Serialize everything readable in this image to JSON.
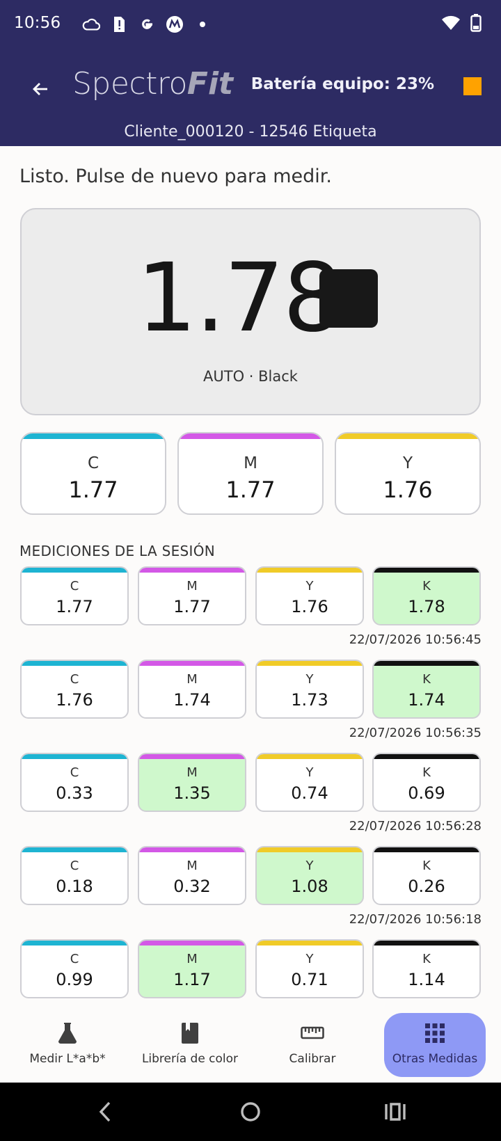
{
  "status_bar": {
    "time": "10:56",
    "left_icons": [
      "cloud-icon",
      "sim-alert-icon",
      "google-icon",
      "motorola-icon",
      "dot-icon"
    ],
    "right_icons": [
      "wifi-icon",
      "battery-icon"
    ]
  },
  "header": {
    "logo_part1": "Spectro",
    "logo_part2": "Fit",
    "battery_label": "Batería equipo: 23%",
    "battery_color": "#ffa200",
    "client_line": "Cliente_000120 - 12546 Etiqueta"
  },
  "message": "Listo. Pulse de nuevo para medir.",
  "reading": {
    "value": "1.78",
    "mode": "AUTO · Black",
    "swatch_color": "#181818"
  },
  "cmy": [
    {
      "label": "C",
      "value": "1.77",
      "color": "#1eb4d2"
    },
    {
      "label": "M",
      "value": "1.77",
      "color": "#d358e6"
    },
    {
      "label": "Y",
      "value": "1.76",
      "color": "#f0cb28"
    }
  ],
  "session_title": "MEDICIONES DE LA SESIÓN",
  "channel_colors": {
    "C": "#1eb4d2",
    "M": "#d358e6",
    "Y": "#f0cb28",
    "K": "#111111"
  },
  "session": [
    {
      "timestamp": "22/07/2026 10:56:45",
      "cells": [
        {
          "label": "C",
          "value": "1.77",
          "highlight": false
        },
        {
          "label": "M",
          "value": "1.77",
          "highlight": false
        },
        {
          "label": "Y",
          "value": "1.76",
          "highlight": false
        },
        {
          "label": "K",
          "value": "1.78",
          "highlight": true
        }
      ]
    },
    {
      "timestamp": "22/07/2026 10:56:35",
      "cells": [
        {
          "label": "C",
          "value": "1.76",
          "highlight": false
        },
        {
          "label": "M",
          "value": "1.74",
          "highlight": false
        },
        {
          "label": "Y",
          "value": "1.73",
          "highlight": false
        },
        {
          "label": "K",
          "value": "1.74",
          "highlight": true
        }
      ]
    },
    {
      "timestamp": "22/07/2026 10:56:28",
      "cells": [
        {
          "label": "C",
          "value": "0.33",
          "highlight": false
        },
        {
          "label": "M",
          "value": "1.35",
          "highlight": true
        },
        {
          "label": "Y",
          "value": "0.74",
          "highlight": false
        },
        {
          "label": "K",
          "value": "0.69",
          "highlight": false
        }
      ]
    },
    {
      "timestamp": "22/07/2026 10:56:18",
      "cells": [
        {
          "label": "C",
          "value": "0.18",
          "highlight": false
        },
        {
          "label": "M",
          "value": "0.32",
          "highlight": false
        },
        {
          "label": "Y",
          "value": "1.08",
          "highlight": true
        },
        {
          "label": "K",
          "value": "0.26",
          "highlight": false
        }
      ]
    },
    {
      "timestamp": "",
      "cells": [
        {
          "label": "C",
          "value": "0.99",
          "highlight": false
        },
        {
          "label": "M",
          "value": "1.17",
          "highlight": true
        },
        {
          "label": "Y",
          "value": "0.71",
          "highlight": false
        },
        {
          "label": "K",
          "value": "1.14",
          "highlight": false
        }
      ]
    }
  ],
  "bottom_nav": [
    {
      "label": "Medir L*a*b*",
      "icon": "flask-icon",
      "active": false
    },
    {
      "label": "Librería de color",
      "icon": "book-icon",
      "active": false
    },
    {
      "label": "Calibrar",
      "icon": "ruler-icon",
      "active": false
    },
    {
      "label": "Otras Medidas",
      "icon": "grid-icon",
      "active": true
    }
  ],
  "system_nav": [
    "back-icon",
    "home-icon",
    "recents-icon"
  ]
}
